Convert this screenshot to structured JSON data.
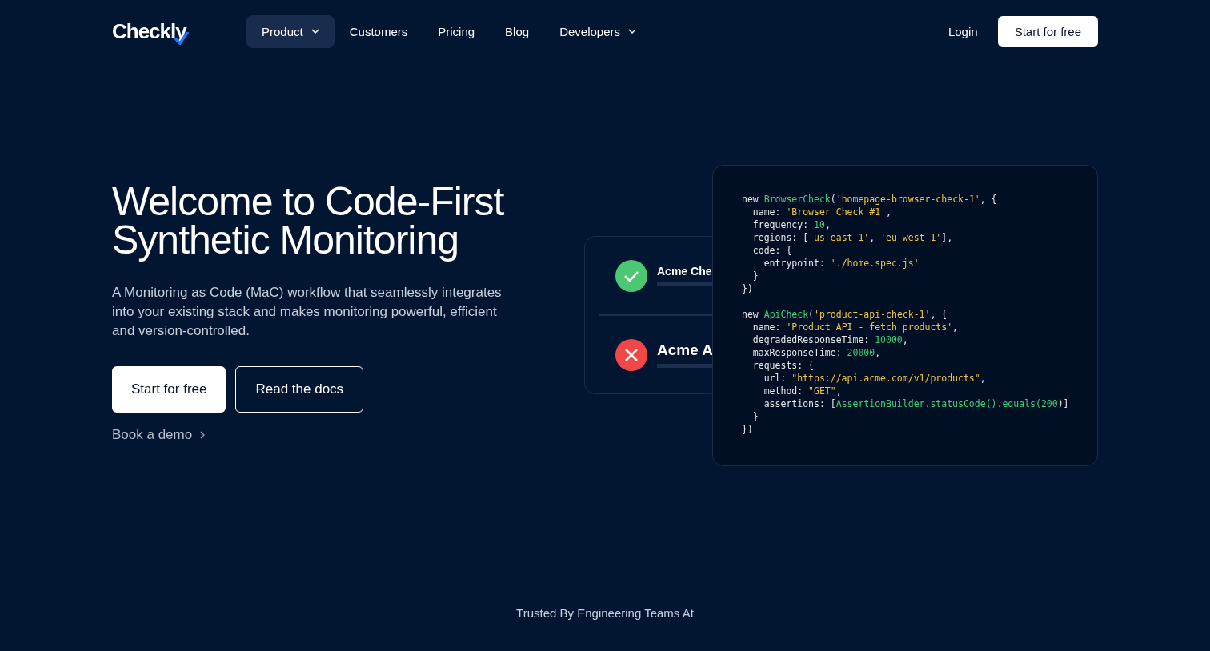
{
  "nav": {
    "logo": "Checkly",
    "items": [
      {
        "label": "Product",
        "selected": true,
        "dropdown": true
      },
      {
        "label": "Customers",
        "selected": false,
        "dropdown": false
      },
      {
        "label": "Pricing",
        "selected": false,
        "dropdown": false
      },
      {
        "label": "Blog",
        "selected": false,
        "dropdown": false
      },
      {
        "label": "Developers",
        "selected": false,
        "dropdown": true
      }
    ],
    "login": "Login",
    "cta": "Start for free"
  },
  "hero": {
    "title": "Welcome to Code-First Synthetic Monitoring",
    "lead": "A Monitoring as Code (MaC) workflow that seamlessly integrates into your existing stack and makes monitoring powerful, efficient and version-controlled.",
    "buttons": [
      {
        "label": "Start for free",
        "kind": "primary"
      },
      {
        "label": "Read the docs",
        "kind": "outline"
      }
    ],
    "demo_link": "Book a demo"
  },
  "checks": [
    {
      "name": "Acme Che",
      "kind": "pass"
    },
    {
      "name": "Acme A",
      "kind": "fail"
    }
  ],
  "code": [
    {
      "lines": [
        [
          {
            "text": "new ",
            "kind": "plain"
          },
          {
            "text": "BrowserCheck",
            "kind": "class"
          },
          {
            "text": "(",
            "kind": "plain"
          },
          {
            "text": "'homepage-browser-check-1'",
            "kind": "string"
          },
          {
            "text": ", {",
            "kind": "plain"
          }
        ],
        [
          {
            "text": "  name: ",
            "kind": "plain"
          },
          {
            "text": "'Browser Check #1'",
            "kind": "string"
          },
          {
            "text": ",",
            "kind": "plain"
          }
        ],
        [
          {
            "text": "  frequency: ",
            "kind": "plain"
          },
          {
            "text": "10",
            "kind": "number"
          },
          {
            "text": ",",
            "kind": "plain"
          }
        ],
        [
          {
            "text": "  regions: [",
            "kind": "plain"
          },
          {
            "text": "'us-east-1'",
            "kind": "string"
          },
          {
            "text": ", ",
            "kind": "plain"
          },
          {
            "text": "'eu-west-1'",
            "kind": "string"
          },
          {
            "text": "],",
            "kind": "plain"
          }
        ],
        [
          {
            "text": "  code: {",
            "kind": "plain"
          }
        ],
        [
          {
            "text": "    entrypoint: ",
            "kind": "plain"
          },
          {
            "text": "'./home.spec.js'",
            "kind": "string"
          }
        ],
        [
          {
            "text": "  }",
            "kind": "plain"
          }
        ],
        [
          {
            "text": "})",
            "kind": "plain"
          }
        ]
      ]
    },
    {
      "lines": [
        [
          {
            "text": "new ",
            "kind": "plain"
          },
          {
            "text": "ApiCheck",
            "kind": "class"
          },
          {
            "text": "(",
            "kind": "plain"
          },
          {
            "text": "'product-api-check-1'",
            "kind": "string"
          },
          {
            "text": ", {",
            "kind": "plain"
          }
        ],
        [
          {
            "text": "  name: ",
            "kind": "plain"
          },
          {
            "text": "'Product API - fetch products'",
            "kind": "string"
          },
          {
            "text": ",",
            "kind": "plain"
          }
        ],
        [
          {
            "text": "  degradedResponseTime: ",
            "kind": "plain"
          },
          {
            "text": "10000",
            "kind": "number"
          },
          {
            "text": ",",
            "kind": "plain"
          }
        ],
        [
          {
            "text": "  maxResponseTime: ",
            "kind": "plain"
          },
          {
            "text": "20000",
            "kind": "number"
          },
          {
            "text": ",",
            "kind": "plain"
          }
        ],
        [
          {
            "text": "  requests: {",
            "kind": "plain"
          }
        ],
        [
          {
            "text": "    url: ",
            "kind": "plain"
          },
          {
            "text": "\"https://api.acme.com/v1/products\"",
            "kind": "string"
          },
          {
            "text": ",",
            "kind": "plain"
          }
        ],
        [
          {
            "text": "    method: ",
            "kind": "plain"
          },
          {
            "text": "\"GET\"",
            "kind": "string"
          },
          {
            "text": ",",
            "kind": "plain"
          }
        ],
        [
          {
            "text": "    assertions: [",
            "kind": "plain"
          },
          {
            "text": "AssertionBuilder.statusCode().equals(",
            "kind": "class"
          },
          {
            "text": "200",
            "kind": "number"
          },
          {
            "text": ")]",
            "kind": "plain"
          }
        ],
        [
          {
            "text": "  }",
            "kind": "plain"
          }
        ],
        [
          {
            "text": "})",
            "kind": "plain"
          }
        ]
      ]
    }
  ],
  "trusted": "Trusted By Engineering Teams At"
}
